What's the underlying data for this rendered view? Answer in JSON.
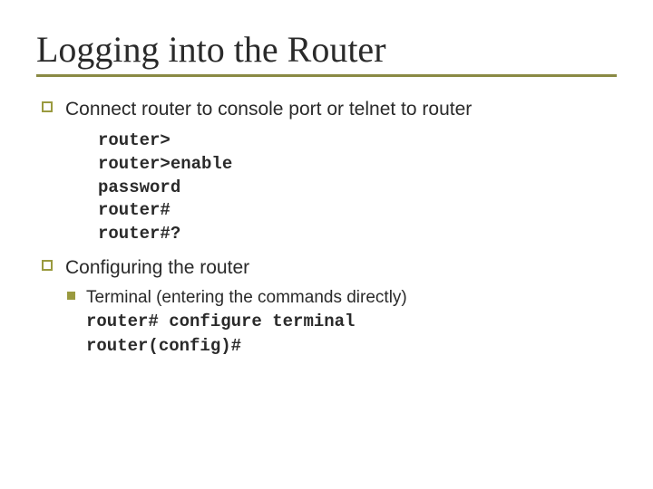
{
  "title": "Logging into the Router",
  "bullets": [
    {
      "text": "Connect router to console port or telnet to router",
      "code": "router>\nrouter>enable\npassword\nrouter#\nrouter#?"
    },
    {
      "text": "Configuring the router",
      "sub": {
        "text": "Terminal (entering the commands directly)",
        "code": "router# configure terminal\nrouter(config)#"
      }
    }
  ]
}
